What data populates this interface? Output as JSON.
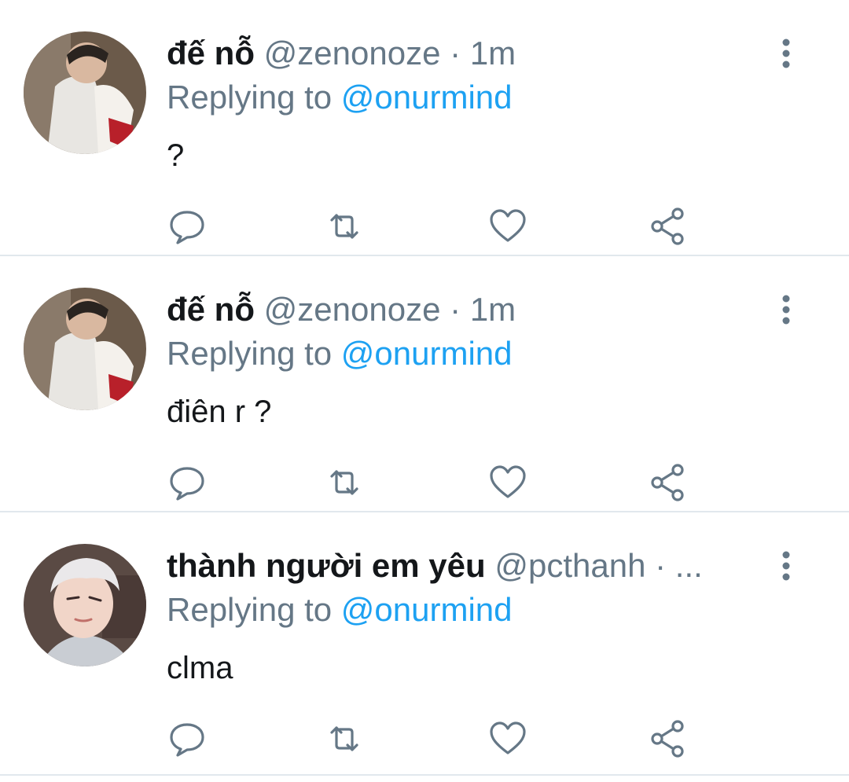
{
  "tweets": [
    {
      "display_name": "đế nỗ",
      "handle": "@zenonoze",
      "separator": "·",
      "time": "1m",
      "reply_prefix": "Replying to",
      "reply_to": "@onurmind",
      "text": "?",
      "avatar_icon": "user-photo-avatar"
    },
    {
      "display_name": "đế nỗ",
      "handle": "@zenonoze",
      "separator": "·",
      "time": "1m",
      "reply_prefix": "Replying to",
      "reply_to": "@onurmind",
      "text": "điên r ?",
      "avatar_icon": "user-photo-avatar"
    },
    {
      "display_name": "thành người em yêu",
      "handle": "@pcthanh",
      "separator": "·",
      "time": "...",
      "reply_prefix": "Replying to",
      "reply_to": "@onurmind",
      "text": "clma",
      "avatar_icon": "user-photo-avatar"
    }
  ],
  "action_icons": [
    "reply-icon",
    "retweet-icon",
    "like-icon",
    "share-icon"
  ],
  "colors": {
    "text": "#14171a",
    "secondary": "#657786",
    "mention": "#1da1f2",
    "divider": "#e1e8ed"
  }
}
